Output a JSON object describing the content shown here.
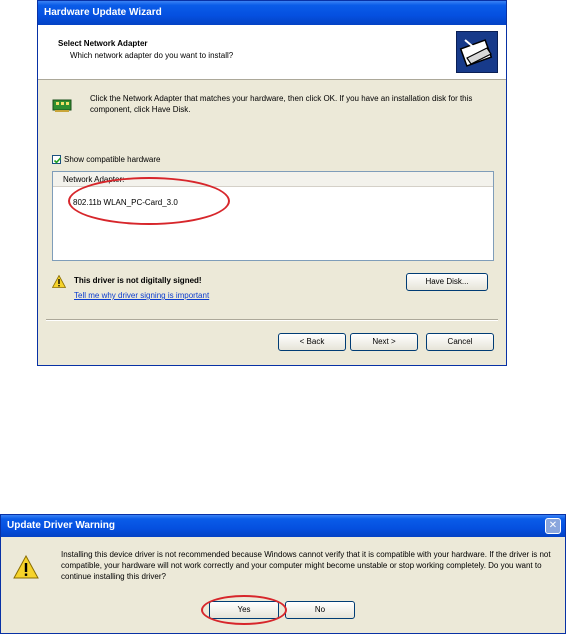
{
  "wizard": {
    "title": "Hardware Update Wizard",
    "header_title": "Select Network Adapter",
    "header_subtitle": "Which network adapter do you want to install?",
    "instructions": "Click the Network Adapter that matches your hardware, then click OK. If you have an installation disk for this component, click Have Disk.",
    "show_compatible_label": "Show compatible hardware",
    "show_compatible_checked": true,
    "list_header": "Network Adapter:",
    "list_items": [
      "802.11b WLAN_PC-Card_3.0"
    ],
    "warning_text": "This driver is not digitally signed!",
    "warning_link": "Tell me why driver signing is important",
    "have_disk_label": "Have Disk...",
    "back_label": "< Back",
    "next_label": "Next >",
    "cancel_label": "Cancel"
  },
  "warning_dialog": {
    "title": "Update Driver Warning",
    "close_glyph": "✕",
    "message": "Installing this device driver is not recommended because Windows cannot verify that it is compatible with your hardware.  If the driver is not compatible, your hardware will not work correctly and your computer might become unstable or stop working completely.  Do you want to continue installing this driver?",
    "yes_label": "Yes",
    "no_label": "No"
  },
  "colors": {
    "title_bar": "#0550e0",
    "dialog_bg": "#ece9d8",
    "highlight_ellipse": "#d7262b",
    "link": "#0b3ccf",
    "warning_yellow": "#f6d32a"
  }
}
